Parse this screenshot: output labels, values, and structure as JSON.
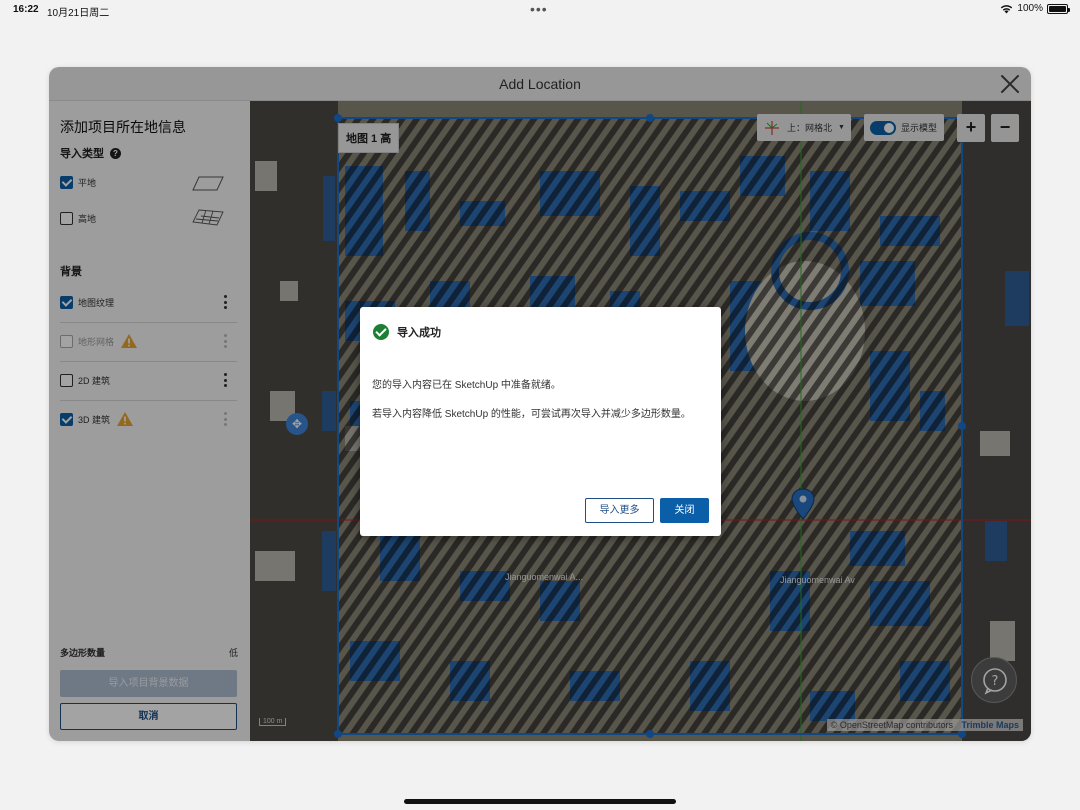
{
  "status_bar": {
    "time": "16:22",
    "date": "10月21日周二",
    "more": "•••",
    "battery_percent": "100%"
  },
  "window": {
    "title": "Add Location"
  },
  "sidebar": {
    "heading": "添加项目所在地信息",
    "import_type_label": "导入类型",
    "import_types": [
      {
        "label": "平地",
        "checked": true
      },
      {
        "label": "高地",
        "checked": false
      }
    ],
    "background_label": "背景",
    "layers": [
      {
        "label": "地图纹理",
        "checked": true,
        "disabled": false,
        "warning": false
      },
      {
        "label": "地形网格",
        "checked": false,
        "disabled": true,
        "warning": true
      },
      {
        "label": "2D 建筑",
        "checked": false,
        "disabled": false,
        "warning": false
      },
      {
        "label": "3D 建筑",
        "checked": true,
        "disabled": false,
        "warning": true
      }
    ],
    "polygon_count_label": "多边形数量",
    "polygon_count_value": "低",
    "import_button": "导入项目背景数据",
    "cancel_button": "取消"
  },
  "map": {
    "title": "地图 1 高",
    "orientation_label": "上：网格北",
    "show_model_label": "显示模型",
    "zoom_in": "+",
    "zoom_out": "−",
    "street_1": "Jianguomenwai A...",
    "street_2": "Jianguomenwai Av",
    "scale": "100 m",
    "attribution": "© OpenStreetMap contributors",
    "brand": "Trimble Maps"
  },
  "dialog": {
    "title": "导入成功",
    "message_1": "您的导入内容已在 SketchUp 中准备就绪。",
    "message_2": "若导入内容降低 SketchUp 的性能，可尝试再次导入并减少多边形数量。",
    "button_more": "导入更多",
    "button_close": "关闭"
  },
  "colors": {
    "accent": "#0b5ea8",
    "success": "#1e7e34",
    "warning": "#e8a531"
  }
}
